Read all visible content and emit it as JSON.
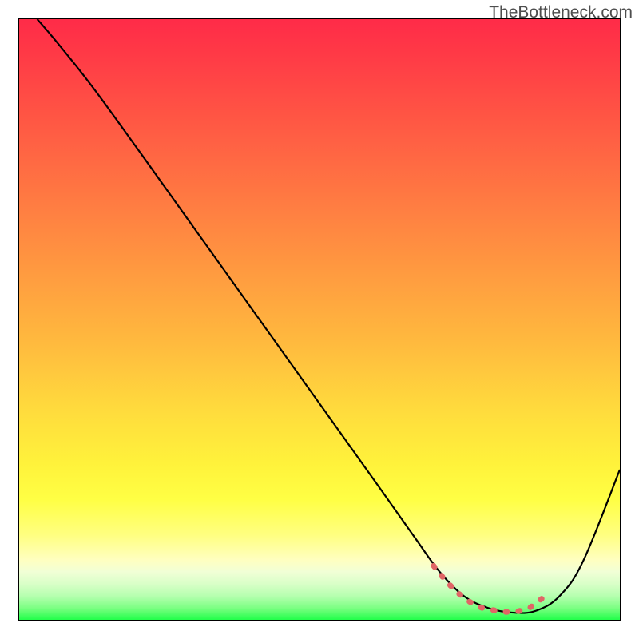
{
  "watermark": "TheBottleneck.com",
  "chart_data": {
    "type": "line",
    "title": "",
    "xlabel": "",
    "ylabel": "",
    "xlim": [
      0,
      100
    ],
    "ylim": [
      0,
      100
    ],
    "grid": false,
    "legend": false,
    "series": [
      {
        "name": "curve",
        "x": [
          3.0,
          6.0,
          12.0,
          20.0,
          30.0,
          40.0,
          50.0,
          60.0,
          66.0,
          70.0,
          74.0,
          78.0,
          82.0,
          86.0,
          90.0,
          94.0,
          100.0
        ],
        "y": [
          100.0,
          96.5,
          89.0,
          78.0,
          64.0,
          50.0,
          36.0,
          22.0,
          13.5,
          8.0,
          4.0,
          2.0,
          1.2,
          1.5,
          4.0,
          10.0,
          25.0
        ],
        "color": "#000000"
      },
      {
        "name": "highlight-band",
        "x": [
          69.0,
          71.0,
          73.0,
          75.0,
          77.0,
          79.0,
          81.0,
          83.0,
          85.0,
          87.0
        ],
        "y": [
          9.0,
          6.5,
          4.5,
          3.0,
          2.0,
          1.6,
          1.3,
          1.4,
          2.0,
          3.5
        ],
        "color": "#e06666"
      }
    ],
    "gradient_stops": [
      {
        "pos": 0.0,
        "color": "#ff2b48"
      },
      {
        "pos": 0.18,
        "color": "#ff5a44"
      },
      {
        "pos": 0.42,
        "color": "#ff9a40"
      },
      {
        "pos": 0.65,
        "color": "#ffdb3d"
      },
      {
        "pos": 0.8,
        "color": "#ffff44"
      },
      {
        "pos": 0.92,
        "color": "#f1ffd6"
      },
      {
        "pos": 1.0,
        "color": "#22ff4a"
      }
    ]
  }
}
